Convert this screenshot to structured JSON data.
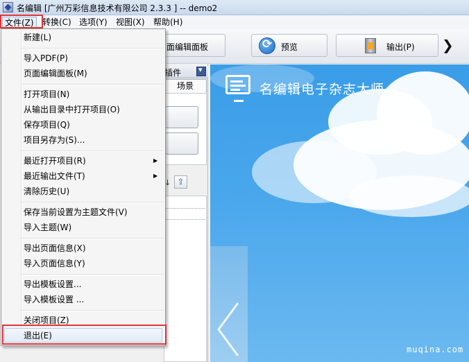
{
  "window": {
    "title": "名编辑 [广州万彩信息技术有限公司 2.3.3 ] -- demo2"
  },
  "menubar": {
    "items": [
      {
        "label": "文件(Z)",
        "active": true
      },
      {
        "label": "转换(C)"
      },
      {
        "label": "选项(Y)"
      },
      {
        "label": "视图(X)"
      },
      {
        "label": "帮助(H)"
      }
    ]
  },
  "toolbar": {
    "page_panel_label": "面编辑面板",
    "preview_label": "预览",
    "output_label": "输出(P)",
    "more_icon": "chevron-right-icon"
  },
  "left_panel": {
    "header_label": "插件",
    "tab_label": "场景",
    "button_1_partial": "‹",
    "button_2_partial": "ˇ"
  },
  "file_menu": {
    "items": [
      {
        "label": "新建(L)"
      },
      {
        "label": "导入PDF(P)"
      },
      {
        "label": "页面编辑面板(M)"
      },
      {
        "label": "打开项目(N)"
      },
      {
        "label": "从输出目录中打开项目(O)"
      },
      {
        "label": "保存项目(Q)"
      },
      {
        "label": "项目另存为(S)..."
      },
      {
        "label": "最近打开项目(R)",
        "submenu": true
      },
      {
        "label": "最近输出文件(T)",
        "submenu": true
      },
      {
        "label": "清除历史(U)"
      },
      {
        "label": "保存当前设置为主题文件(V)"
      },
      {
        "label": "导入主题(W)"
      },
      {
        "label": "导出页面信息(X)"
      },
      {
        "label": "导入页面信息(Y)"
      },
      {
        "label": "导出模板设置..."
      },
      {
        "label": "导入模板设置 ..."
      },
      {
        "label": "关闭项目(Z)"
      },
      {
        "label": "退出(E)",
        "highlighted": true
      }
    ]
  },
  "preview": {
    "brand_text": "名编辑电子杂志大师"
  },
  "watermark": "muqina.com",
  "colors": {
    "highlight_border": "#e0343a",
    "sky_blue": "#3a9de8"
  }
}
